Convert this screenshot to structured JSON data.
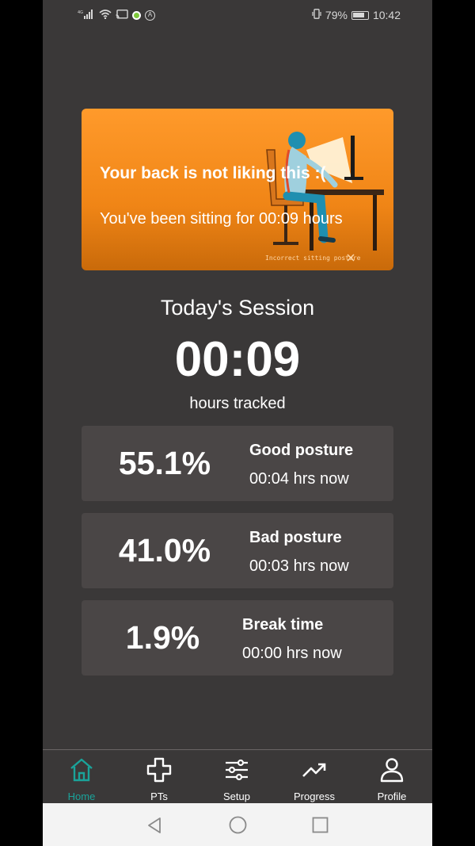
{
  "status_bar": {
    "network": "4G",
    "battery_percent": "79%",
    "time": "10:42"
  },
  "banner": {
    "title": "Your back is not liking this :(",
    "subtitle": "You've been sitting for 00:09 hours",
    "image_caption": "Incorrect sitting posture"
  },
  "session": {
    "title": "Today's Session",
    "time": "00:09",
    "unit": "hours tracked"
  },
  "stats": [
    {
      "percent": "55.1%",
      "label": "Good posture",
      "duration": "00:04 hrs now"
    },
    {
      "percent": "41.0%",
      "label": "Bad posture",
      "duration": "00:03 hrs now"
    },
    {
      "percent": "1.9%",
      "label": "Break time",
      "duration": "00:00 hrs now"
    }
  ],
  "nav": {
    "home": "Home",
    "pts": "PTs",
    "setup": "Setup",
    "progress": "Progress",
    "profile": "Profile"
  },
  "colors": {
    "background": "#3a3838",
    "card": "#4a4646",
    "banner": "#f08516",
    "accent": "#1aa39a"
  }
}
